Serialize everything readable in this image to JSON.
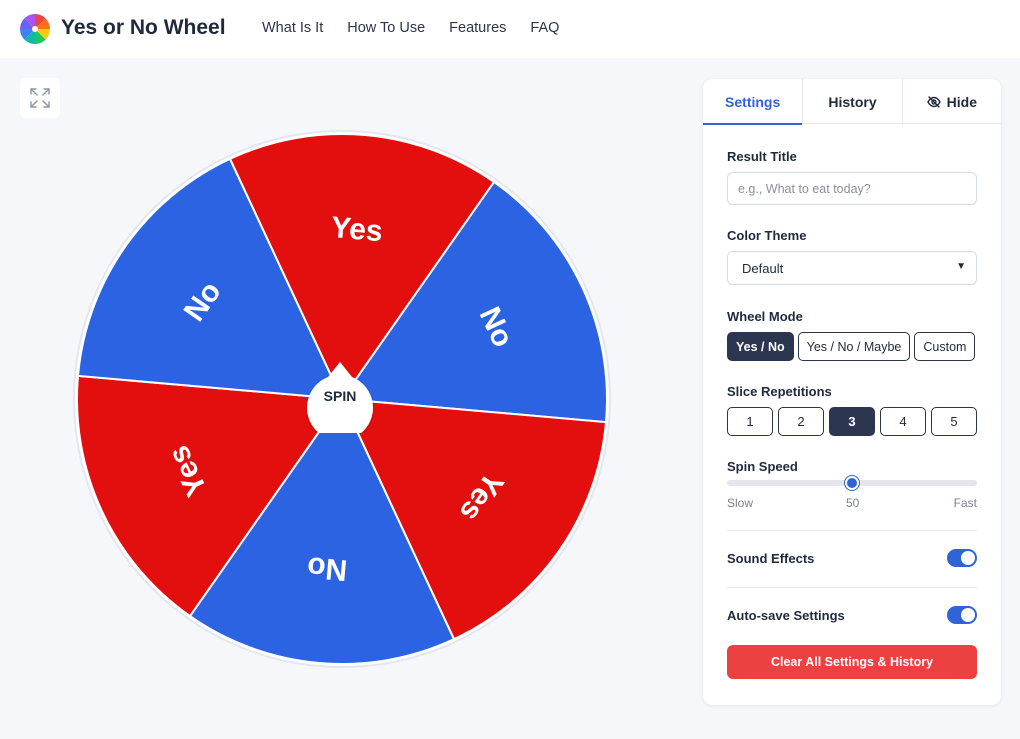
{
  "brand": {
    "name": "Yes or No Wheel",
    "logo": "rainbow-wheel-logo"
  },
  "nav": [
    {
      "label": "What Is It"
    },
    {
      "label": "How To Use"
    },
    {
      "label": "Features"
    },
    {
      "label": "FAQ"
    }
  ],
  "fullscreen": {
    "icon": "expand-icon"
  },
  "wheel": {
    "spin_label": "SPIN",
    "colors": {
      "yes": "#e30f0f",
      "no": "#2b63e3"
    },
    "slices": [
      {
        "label": "No",
        "color": "no"
      },
      {
        "label": "Yes",
        "color": "yes"
      },
      {
        "label": "No",
        "color": "no"
      },
      {
        "label": "Yes",
        "color": "yes"
      },
      {
        "label": "No",
        "color": "no"
      },
      {
        "label": "Yes",
        "color": "yes"
      }
    ]
  },
  "panel": {
    "tabs": [
      {
        "label": "Settings",
        "active": true
      },
      {
        "label": "History",
        "active": false
      },
      {
        "label": "Hide",
        "active": false,
        "icon": "eye-slash-icon"
      }
    ],
    "result_title": {
      "label": "Result Title",
      "placeholder": "e.g., What to eat today?"
    },
    "color_theme": {
      "label": "Color Theme",
      "selected": "Default"
    },
    "wheel_mode": {
      "label": "Wheel Mode",
      "options": [
        "Yes / No",
        "Yes / No / Maybe",
        "Custom"
      ],
      "selected": "Yes / No"
    },
    "slice_repetitions": {
      "label": "Slice Repetitions",
      "options": [
        "1",
        "2",
        "3",
        "4",
        "5"
      ],
      "selected": "3"
    },
    "spin_speed": {
      "label": "Spin Speed",
      "min_label": "Slow",
      "value_label": "50",
      "max_label": "Fast",
      "value": 50,
      "min": 0,
      "max": 100
    },
    "sound_effects": {
      "label": "Sound Effects",
      "on": true
    },
    "auto_save": {
      "label": "Auto-save Settings",
      "on": true
    },
    "clear_button": {
      "label": "Clear All Settings & History"
    },
    "accent_color": "#2f63d6",
    "danger_color": "#ec4141"
  }
}
